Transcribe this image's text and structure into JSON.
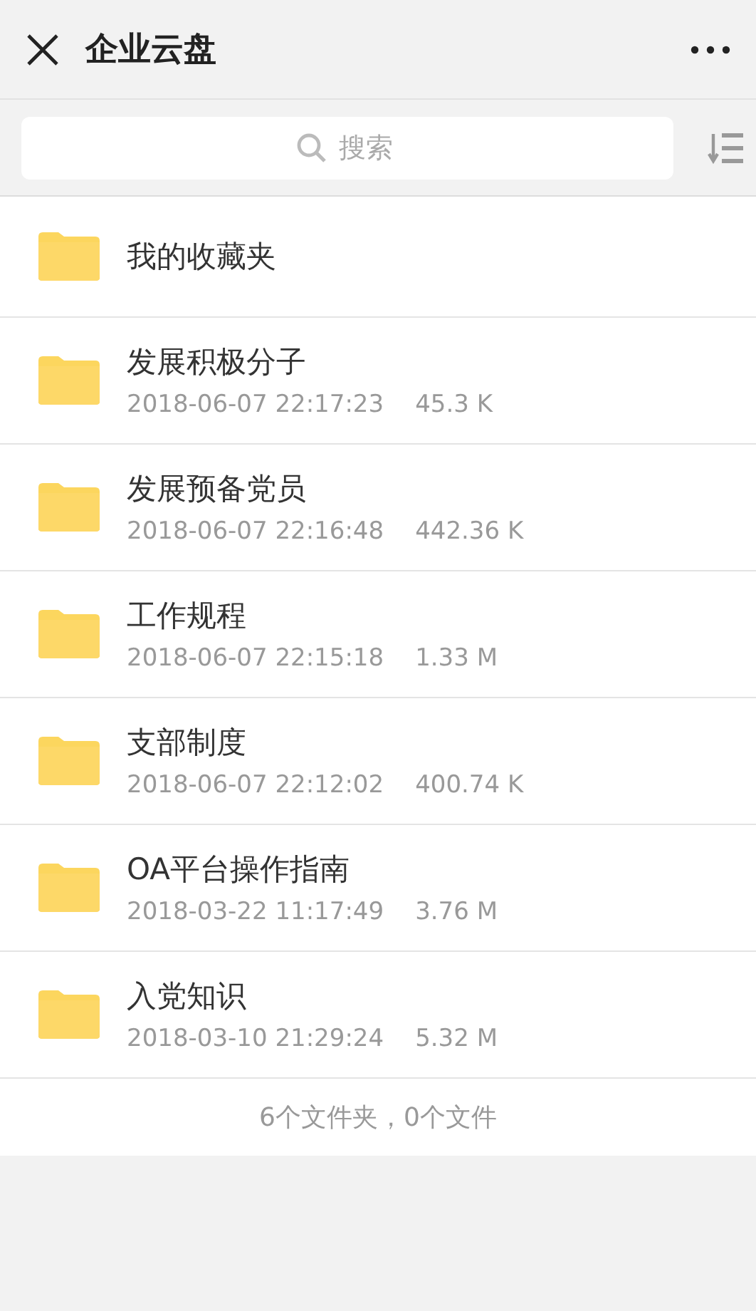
{
  "header": {
    "title": "企业云盘"
  },
  "search": {
    "placeholder": "搜索"
  },
  "folders": [
    {
      "name": "我的收藏夹"
    },
    {
      "name": "发展积极分子",
      "date": "2018-06-07 22:17:23",
      "size": "45.3 K"
    },
    {
      "name": "发展预备党员",
      "date": "2018-06-07 22:16:48",
      "size": "442.36 K"
    },
    {
      "name": "工作规程",
      "date": "2018-06-07 22:15:18",
      "size": "1.33 M"
    },
    {
      "name": "支部制度",
      "date": "2018-06-07 22:12:02",
      "size": "400.74 K"
    },
    {
      "name": "OA平台操作指南",
      "date": "2018-03-22 11:17:49",
      "size": "3.76 M"
    },
    {
      "name": "入党知识",
      "date": "2018-03-10 21:29:24",
      "size": "5.32 M"
    }
  ],
  "footer": "6个文件夹，0个文件"
}
